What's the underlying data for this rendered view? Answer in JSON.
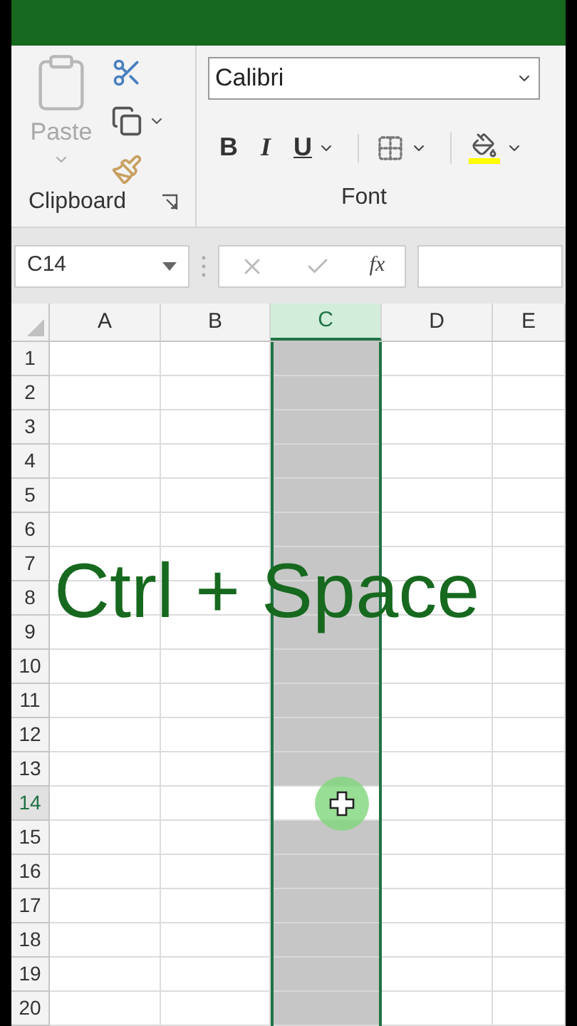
{
  "ribbon": {
    "clipboard": {
      "paste_label": "Paste",
      "group_label": "Clipboard"
    },
    "font": {
      "font_name": "Calibri",
      "bold": "B",
      "italic": "I",
      "underline": "U",
      "group_label": "Font"
    }
  },
  "formula_bar": {
    "name_box": "C14",
    "fx": "fx"
  },
  "columns": [
    {
      "label": "A",
      "selected": false
    },
    {
      "label": "B",
      "selected": false
    },
    {
      "label": "C",
      "selected": true
    },
    {
      "label": "D",
      "selected": false
    },
    {
      "label": "E",
      "selected": false
    }
  ],
  "rows": [
    {
      "label": "1",
      "active": false
    },
    {
      "label": "2",
      "active": false
    },
    {
      "label": "3",
      "active": false
    },
    {
      "label": "4",
      "active": false
    },
    {
      "label": "5",
      "active": false
    },
    {
      "label": "6",
      "active": false
    },
    {
      "label": "7",
      "active": false
    },
    {
      "label": "8",
      "active": false
    },
    {
      "label": "9",
      "active": false
    },
    {
      "label": "10",
      "active": false
    },
    {
      "label": "11",
      "active": false
    },
    {
      "label": "12",
      "active": false
    },
    {
      "label": "13",
      "active": false
    },
    {
      "label": "14",
      "active": true
    },
    {
      "label": "15",
      "active": false
    },
    {
      "label": "16",
      "active": false
    },
    {
      "label": "17",
      "active": false
    },
    {
      "label": "18",
      "active": false
    },
    {
      "label": "19",
      "active": false
    },
    {
      "label": "20",
      "active": false
    }
  ],
  "caption": "Ctrl + Space"
}
